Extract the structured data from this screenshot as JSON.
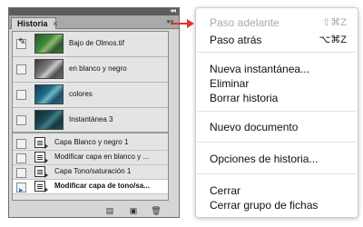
{
  "panel": {
    "collapse_icon": "◂◂",
    "tab_label": "Historia",
    "tab_close": "✕",
    "menu_icon": "▾≡",
    "snapshots": [
      {
        "label": "Bajo de Olmos.tif",
        "thumb": "color-forest"
      },
      {
        "label": "en blanco y negro",
        "thumb": "grayscale-forest"
      },
      {
        "label": "colores",
        "thumb": "cyan-forest"
      },
      {
        "label": "Instantánea 3",
        "thumb": "dark-teal-forest"
      }
    ],
    "history_states": [
      {
        "label": "Capa Blanco y negro 1"
      },
      {
        "label": "Modificar capa en blanco y ..."
      },
      {
        "label": "Capa Tono/saturación 1"
      },
      {
        "label": "Modificar capa de tono/sa..."
      }
    ],
    "footer": {
      "new_document_icon": "▤",
      "new_snapshot_icon": "▣",
      "delete_icon": "🗑"
    }
  },
  "menu": {
    "step_forward": {
      "label": "Paso adelante",
      "shortcut": "⇧⌘Z"
    },
    "step_backward": {
      "label": "Paso atrás",
      "shortcut": "⌥⌘Z"
    },
    "new_snapshot": {
      "label": "Nueva instantánea..."
    },
    "delete": {
      "label": "Eliminar"
    },
    "clear_history": {
      "label": "Borrar historia"
    },
    "new_document": {
      "label": "Nuevo documento"
    },
    "history_options": {
      "label": "Opciones de historia..."
    },
    "close": {
      "label": "Cerrar"
    },
    "close_tab_group": {
      "label": "Cerrar grupo de fichas"
    }
  },
  "colors": {
    "arrow": "#e23232",
    "selection_marker": "#2c6fd1",
    "disabled_text": "#a8a8a8"
  }
}
